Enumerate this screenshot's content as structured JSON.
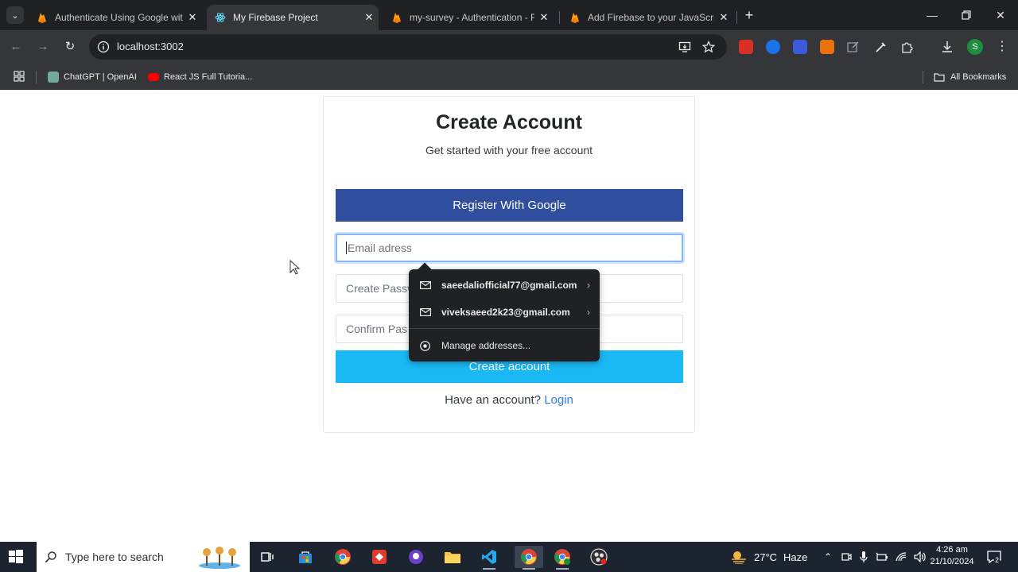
{
  "browser": {
    "tabs": [
      {
        "title": "Authenticate Using Google with",
        "active": false,
        "icon": "firebase-icon"
      },
      {
        "title": "My Firebase Project",
        "active": true,
        "icon": "react-icon"
      },
      {
        "title": "my-survey - Authentication - Fi",
        "active": false,
        "icon": "firebase-icon"
      },
      {
        "title": "Add Firebase to your JavaScript",
        "active": false,
        "icon": "firebase-icon"
      }
    ],
    "url": "localhost:3002",
    "bookmarks": [
      {
        "label": "ChatGPT | OpenAI",
        "icon": "openai-icon"
      },
      {
        "label": "React JS Full Tutoria...",
        "icon": "youtube-icon"
      }
    ],
    "all_bookmarks": "All Bookmarks",
    "profile_initial": "S"
  },
  "form": {
    "title": "Create Account",
    "subtitle": "Get started with your free account",
    "google_button": "Register With Google",
    "email_placeholder": "Email adress",
    "password_placeholder": "Create Password",
    "password_visible": "Create Passv",
    "confirm_placeholder": "Confirm Password",
    "confirm_visible": "Confirm Pas",
    "submit_button": "Create account",
    "have_account": "Have an account?",
    "login_link": "Login"
  },
  "autofill": {
    "suggestions": [
      "saeedaliofficial77@gmail.com",
      "viveksaeed2k23@gmail.com"
    ],
    "manage": "Manage addresses..."
  },
  "taskbar": {
    "search_placeholder": "Type here to search",
    "weather_temp": "27°C",
    "weather_desc": "Haze",
    "time": "4:26 am",
    "date": "21/10/2024",
    "notification_count": "2"
  },
  "colors": {
    "google_button": "#2f4f9e",
    "submit_button": "#1ab9f5",
    "link": "#2d7de0",
    "focus_ring": "#86b7fe"
  }
}
